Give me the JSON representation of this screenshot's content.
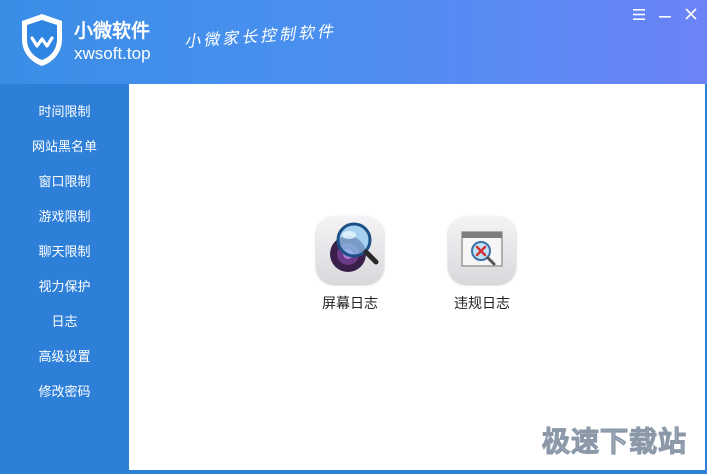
{
  "header": {
    "app_name": "小微软件",
    "app_domain": "xwsoft.top",
    "slogan": "小微家长控制软件"
  },
  "window_controls": {
    "menu_icon": "menu-icon",
    "minimize_icon": "minimize-icon",
    "close_icon": "close-icon"
  },
  "sidebar": {
    "items": [
      {
        "label": "时间限制"
      },
      {
        "label": "网站黑名单"
      },
      {
        "label": "窗口限制"
      },
      {
        "label": "游戏限制"
      },
      {
        "label": "聊天限制"
      },
      {
        "label": "视力保护"
      },
      {
        "label": "日志"
      },
      {
        "label": "高级设置"
      },
      {
        "label": "修改密码"
      }
    ]
  },
  "content": {
    "tiles": [
      {
        "label": "屏幕日志",
        "icon": "magnifier-icon"
      },
      {
        "label": "违规日志",
        "icon": "violation-window-icon"
      }
    ]
  },
  "watermark": "极速下载站",
  "colors": {
    "sidebar_bg": "#2d7fd8",
    "header_start": "#3a8ee6",
    "header_end": "#6b83f5",
    "content_bg": "#ffffff"
  }
}
